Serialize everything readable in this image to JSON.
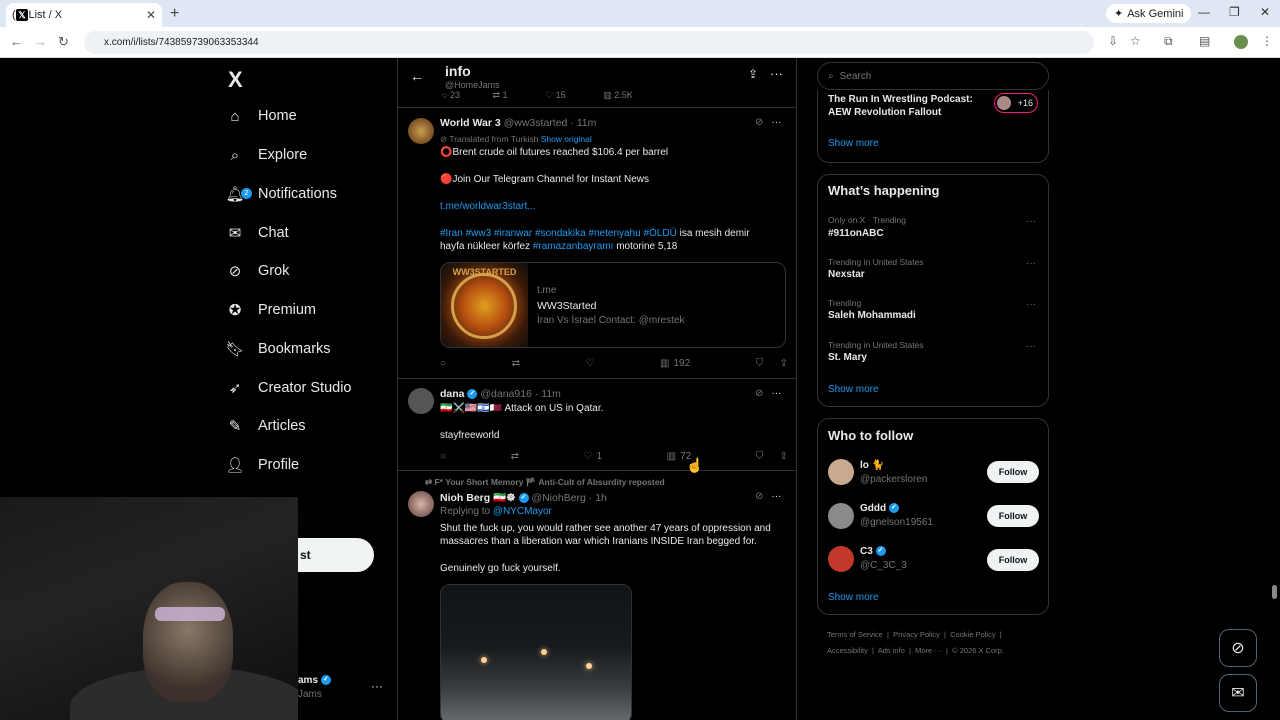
{
  "browser": {
    "tab_title": "(2) List / X",
    "url": "x.com/i/lists/743859739063353344",
    "ask_gemini": "Ask Gemini"
  },
  "nav": {
    "logo": "X",
    "items": [
      {
        "label": "Home",
        "icon": "home-icon"
      },
      {
        "label": "Explore",
        "icon": "search-icon"
      },
      {
        "label": "Notifications",
        "icon": "bell-icon",
        "badge": "2"
      },
      {
        "label": "Chat",
        "icon": "mail-icon"
      },
      {
        "label": "Grok",
        "icon": "grok-icon"
      },
      {
        "label": "Premium",
        "icon": "verified-icon"
      },
      {
        "label": "Bookmarks",
        "icon": "bookmark-icon"
      },
      {
        "label": "Creator Studio",
        "icon": "rocket-icon"
      },
      {
        "label": "Articles",
        "icon": "article-icon"
      },
      {
        "label": "Profile",
        "icon": "person-icon"
      }
    ],
    "post_button": "st",
    "account_name": "ams",
    "account_handle": "Jams"
  },
  "header": {
    "title": "info",
    "subtitle": "@HomeJams",
    "prev_actions": {
      "replies": "23",
      "reposts": "1",
      "likes": "15",
      "views": "2.5K"
    }
  },
  "tweets": [
    {
      "name": "World War 3",
      "handle": "@ww3started",
      "time": "· 11m",
      "translated": "Translated from Turkish",
      "show_original": "Show original",
      "line1": "⭕Brent crude oil futures reached $106.4 per barrel",
      "line2": "🔴Join Our Telegram Channel for Instant News",
      "link": "t.me/worldwar3start...",
      "hashtags": "#Iran #ww3 #iranwar #sondakika #netenyahu #ÖLDÜ",
      "after_tags": " isa mesih demir",
      "line5a": "hayfa nükleer körfez ",
      "line5tag": "#ramazanbayramı",
      "line5b": " motorine 5,18",
      "card": {
        "domain": "t.me",
        "title": "WW3Started",
        "desc": "İran Vs İsrael Contact: @mrestek",
        "img_text": "WW3STARTED"
      },
      "actions": {
        "replies": "",
        "reposts": "",
        "likes": "",
        "views": "192"
      }
    },
    {
      "name": "dana",
      "handle": "@dana916",
      "time": "· 11m",
      "line1": "🇮🇷⚔️🇺🇸🇮🇱🇶🇦 Attack on US in Qatar.",
      "line2": "stayfreeworld",
      "actions": {
        "replies": "",
        "reposts": "",
        "likes": "1",
        "views": "72"
      }
    },
    {
      "repost_by": "F* Your Short Memory 🏴 Anti-Cult of Absurdity reposted",
      "name": "Nioh Berg",
      "flags": "🇮🇷☸",
      "handle": "@NiohBerg",
      "time": "· 1h",
      "replying": "Replying to",
      "replying_to": "@NYCMayor",
      "line1": "Shut the fuck up, you would rather see another 47 years of oppression and",
      "line2": "massacres than a liberation war which Iranians INSIDE Iran begged for.",
      "line3": "Genuinely go fuck yourself."
    }
  ],
  "search": {
    "placeholder": "Search"
  },
  "spaces": {
    "title": "The Run In Wrestling Podcast: AEW Revolution Fallout",
    "count": "+16",
    "show_more": "Show more"
  },
  "happening": {
    "title": "What’s happening",
    "trends": [
      {
        "meta": "Only on X · Trending",
        "name": "#911onABC"
      },
      {
        "meta": "Trending in United States",
        "name": "Nexstar"
      },
      {
        "meta": "Trending",
        "name": "Saleh Mohammadi"
      },
      {
        "meta": "Trending in United States",
        "name": "St. Mary"
      }
    ],
    "show_more": "Show more"
  },
  "follow": {
    "title": "Who to follow",
    "users": [
      {
        "name": "lo 🐈",
        "handle": "@packersloren",
        "button": "Follow",
        "color": "#c9a98f"
      },
      {
        "name": "Gddd",
        "handle": "@gnelson19561",
        "button": "Follow",
        "color": "#8a8a8a"
      },
      {
        "name": "C3",
        "handle": "@C_3C_3",
        "button": "Follow",
        "color": "#c0392b"
      }
    ],
    "show_more": "Show more"
  },
  "footer": {
    "line1": [
      "Terms of Service",
      "Privacy Policy",
      "Cookie Policy"
    ],
    "line2": [
      "Accessibility",
      "Ads info",
      "More ···",
      "© 2026 X Corp."
    ]
  },
  "colors": {
    "accent": "#1d9bf0",
    "background": "#000000",
    "border": "#2f3336",
    "muted": "#71767b"
  }
}
